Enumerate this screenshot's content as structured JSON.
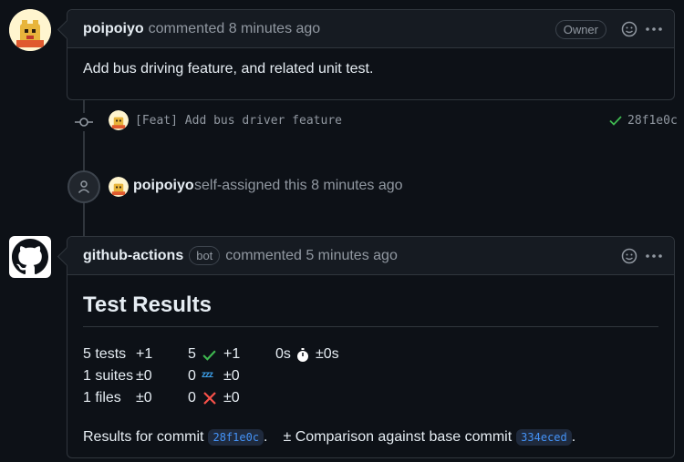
{
  "comment1": {
    "author": "poipoiyo",
    "action": "commented 8 minutes ago",
    "owner_badge": "Owner",
    "body": "Add bus driving feature, and related unit test."
  },
  "commit": {
    "message": "[Feat] Add bus driver feature",
    "sha": "28f1e0c",
    "status_color": "#3fb950"
  },
  "assign_event": {
    "actor": "poipoiyo",
    "text": "self-assigned this 8 minutes ago"
  },
  "comment2": {
    "author": "github-actions",
    "bot_label": "bot",
    "action": "commented 5 minutes ago",
    "heading": "Test Results",
    "rows": [
      {
        "a": "5 tests",
        "a_delta": "+1",
        "b": "5",
        "b_icon": "check-icon",
        "b_delta": "+1",
        "c": "0s",
        "c_icon": "stopwatch-icon",
        "c_delta": "±0s"
      },
      {
        "a": "1 suites",
        "a_delta": "±0",
        "b": "0",
        "b_icon": "zzz-icon",
        "b_delta": "±0"
      },
      {
        "a": "1 files",
        "a_delta": "±0",
        "b": "0",
        "b_icon": "x-icon",
        "b_delta": "±0"
      }
    ],
    "results_prefix": "Results for commit",
    "results_sha": "28f1e0c",
    "results_dot": ".",
    "comparison_text": "± Comparison against base commit",
    "base_sha": "334eced",
    "end_dot": "."
  }
}
